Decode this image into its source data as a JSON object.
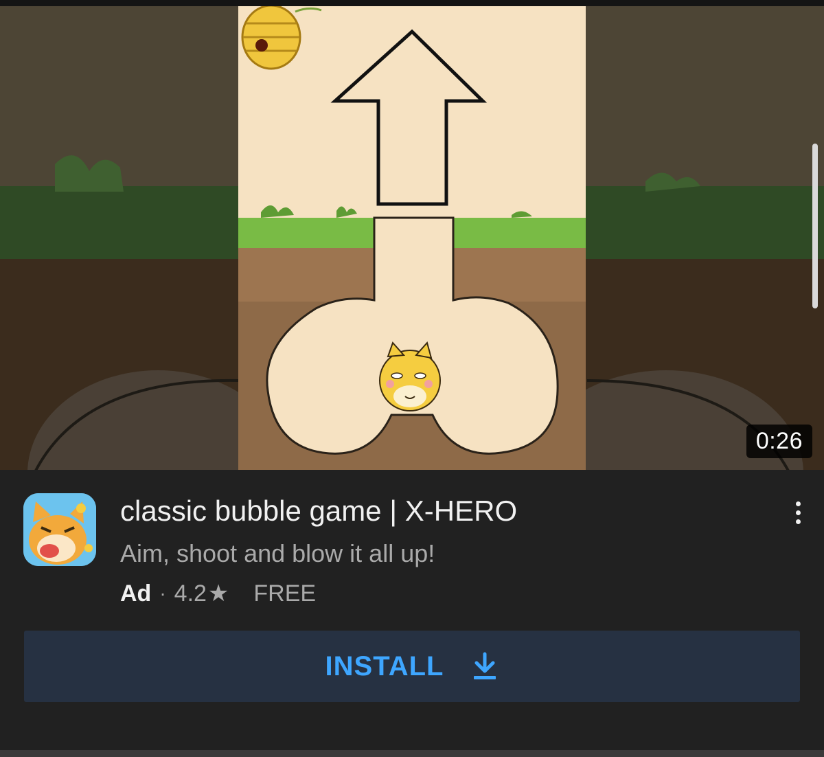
{
  "video": {
    "duration": "0:26"
  },
  "ad": {
    "icon": "app-icon-shiba-dog",
    "title": "classic bubble game | X-HERO",
    "subtitle": "Aim, shoot and blow it all up!",
    "badge": "Ad",
    "separator": "·",
    "rating": "4.2",
    "rating_icon": "star-icon",
    "price": "FREE"
  },
  "install": {
    "label": "INSTALL",
    "icon": "download-icon"
  },
  "menu": {
    "icon": "more-vert-icon"
  },
  "colors": {
    "background": "#212121",
    "accent": "#3ea6ff",
    "button_bg": "#263142",
    "text_primary": "#f1f1f1",
    "text_secondary": "#aaaaaa"
  }
}
